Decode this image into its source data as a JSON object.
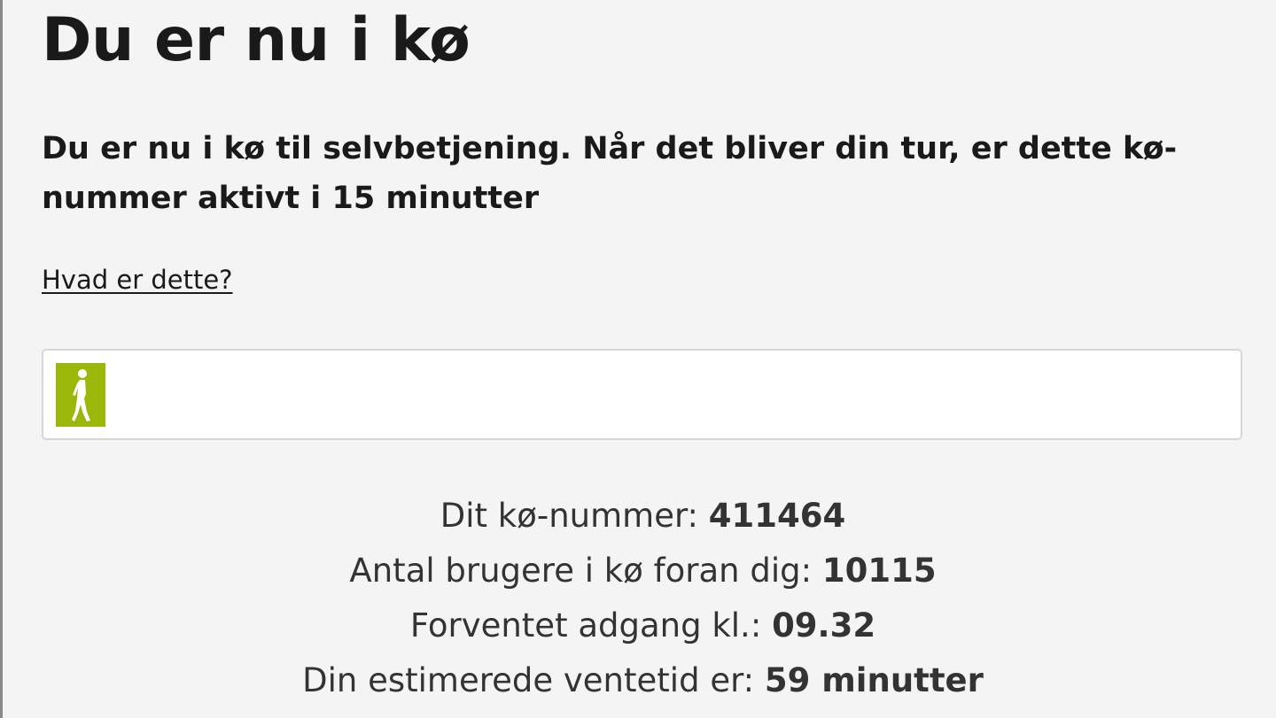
{
  "page": {
    "title": "Du er nu i kø",
    "intro": "Du er nu i kø til selvbetjening. Når det bliver din tur, er dette kø-nummer aktivt i 15 minutter",
    "help_link": "Hvad er dette?"
  },
  "progress": {
    "fraction": 0.04,
    "color": "#9bb70a",
    "icon": "walking-person-icon"
  },
  "queue_info": {
    "queue_number_label": "Dit kø-nummer: ",
    "queue_number": "411464",
    "users_ahead_label": "Antal brugere i kø foran dig: ",
    "users_ahead": "10115",
    "expected_access_label": "Forventet adgang kl.: ",
    "expected_access": "09.32",
    "estimated_wait_label": "Din estimerede ventetid er: ",
    "estimated_wait": "59 minutter"
  }
}
